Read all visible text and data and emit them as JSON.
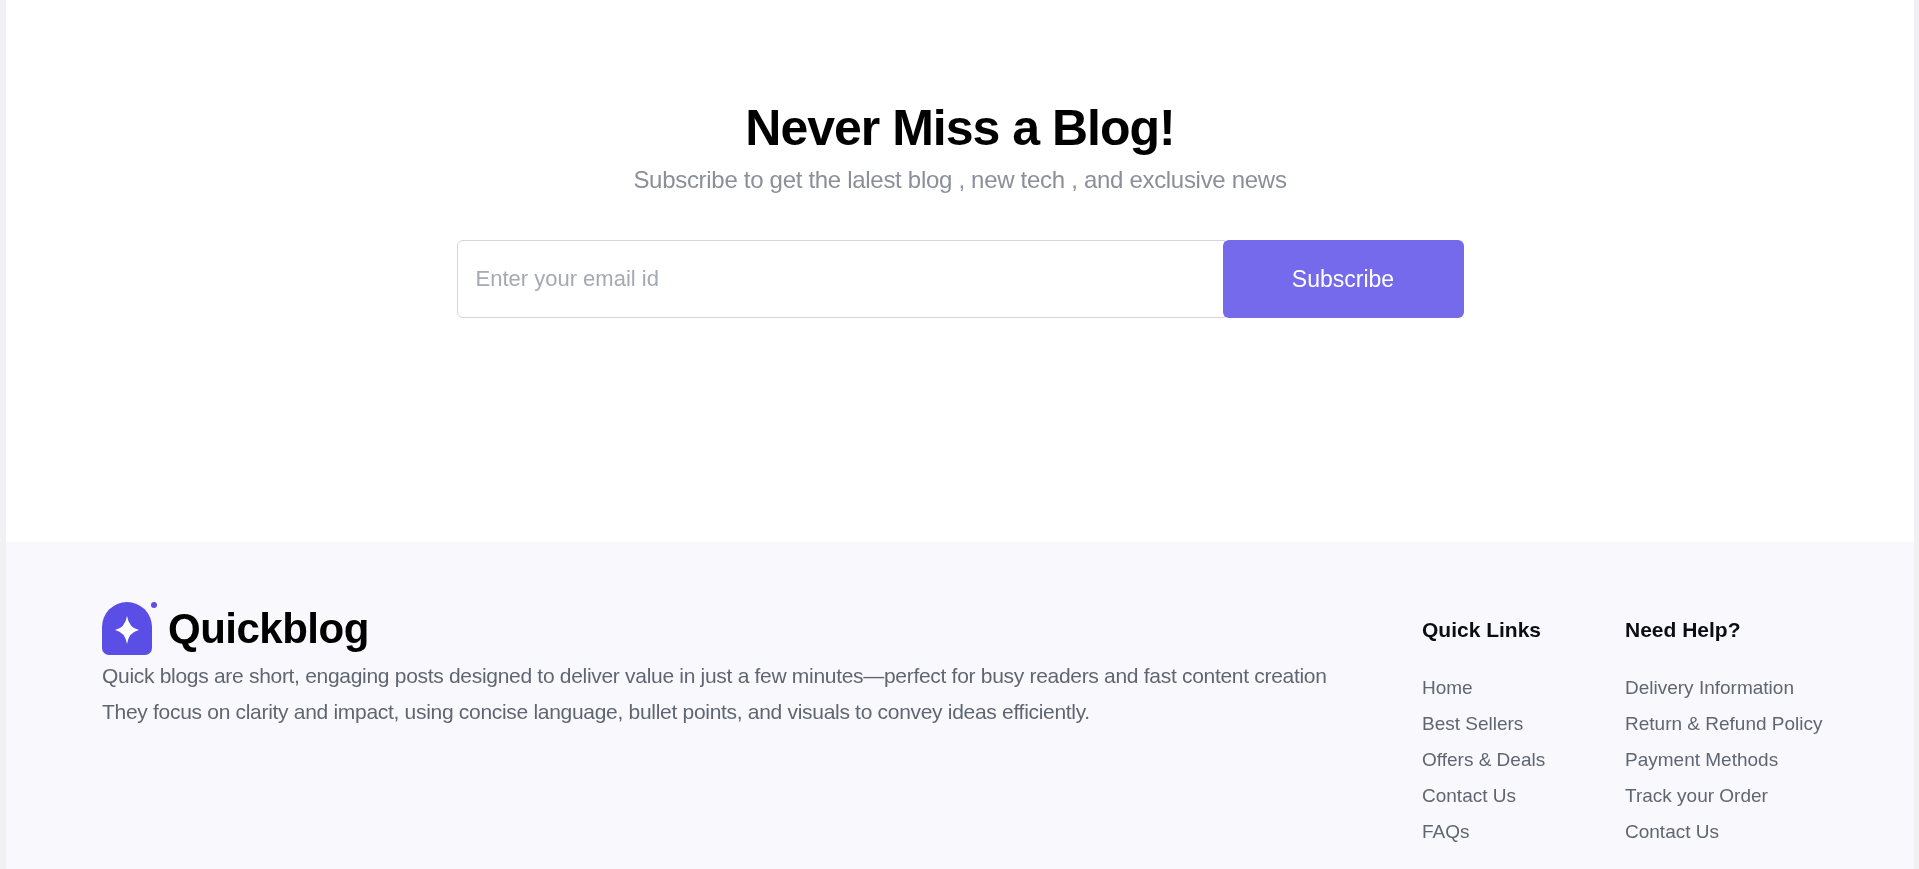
{
  "newsletter": {
    "title": "Never Miss a Blog!",
    "subtitle": "Subscribe to get the lalest blog , new tech , and exclusive news",
    "email_field": {
      "placeholder": "Enter your email id"
    },
    "button": "Subscribe"
  },
  "footer": {
    "brand": "Quickblog",
    "description": "Quick blogs are short, engaging posts designed to deliver value in just a few minutes—perfect for busy readers and fast content creation They focus on clarity and impact, using concise language, bullet points, and visuals to convey ideas efficiently.",
    "columns": [
      {
        "title": "Quick Links",
        "links": [
          "Home",
          "Best Sellers",
          "Offers & Deals",
          "Contact Us",
          "FAQs"
        ]
      },
      {
        "title": "Need Help?",
        "links": [
          "Delivery Information",
          "Return & Refund Policy",
          "Payment Methods",
          "Track your Order",
          "Contact Us"
        ]
      }
    ]
  }
}
